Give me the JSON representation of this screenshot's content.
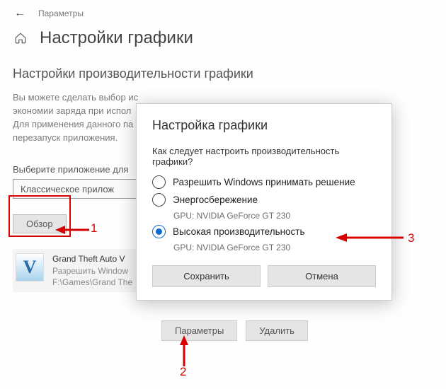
{
  "topbar": {
    "title": "Параметры"
  },
  "page": {
    "title": "Настройки графики"
  },
  "section": {
    "title": "Настройки производительности графики"
  },
  "description": {
    "line1": "Вы можете сделать выбор ис",
    "line2": "экономии заряда при испол",
    "line3": "Для применения данного па",
    "line4": "перезапуск приложения."
  },
  "select": {
    "label": "Выберите приложение для",
    "value": "Классическое прилож"
  },
  "browse": {
    "label": "Обзор"
  },
  "app": {
    "name": "Grand Theft Auto V",
    "line1": "Разрешить Window",
    "line2": "F:\\Games\\Grand The",
    "iconLetter": "V"
  },
  "bottom": {
    "params": "Параметры",
    "delete": "Удалить"
  },
  "dialog": {
    "title": "Настройка графики",
    "question": "Как следует настроить производительность графики?",
    "opt1": "Разрешить Windows принимать решение",
    "opt2": "Энергосбережение",
    "opt2desc": "GPU: NVIDIA GeForce GT 230",
    "opt3": "Высокая производительность",
    "opt3desc": "GPU: NVIDIA GeForce GT 230",
    "save": "Сохранить",
    "cancel": "Отмена"
  },
  "annotations": {
    "n1": "1",
    "n2": "2",
    "n3": "3"
  }
}
